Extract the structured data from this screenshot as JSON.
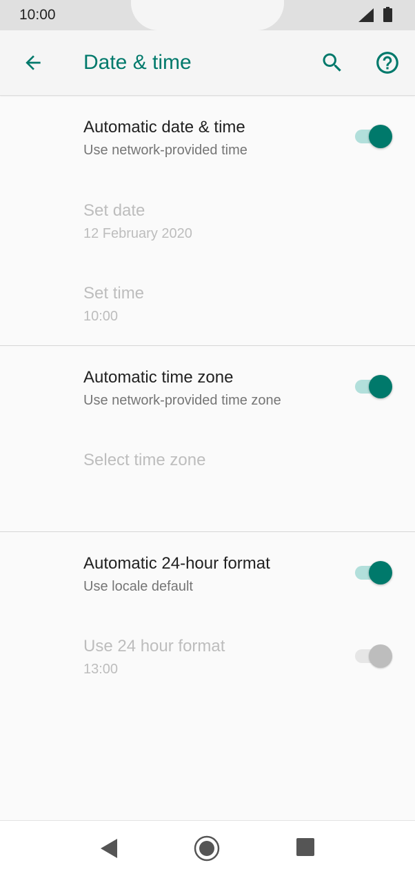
{
  "status_bar": {
    "time": "10:00",
    "icons": [
      "signal-icon",
      "battery-icon"
    ]
  },
  "app_bar": {
    "title": "Date & time",
    "icons": [
      "back-arrow-icon",
      "search-icon",
      "help-icon"
    ]
  },
  "colors": {
    "accent": "#00796b",
    "switch_track_on": "#b2dfdb",
    "text_primary": "#212121",
    "text_secondary": "#757575",
    "text_disabled": "#bdbdbd"
  },
  "prefs": {
    "auto_date_time": {
      "title": "Automatic date & time",
      "summary": "Use network-provided time",
      "checked": true,
      "enabled": true
    },
    "set_date": {
      "title": "Set date",
      "summary": "12 February 2020",
      "enabled": false
    },
    "set_time": {
      "title": "Set time",
      "summary": "10:00",
      "enabled": false
    },
    "auto_time_zone": {
      "title": "Automatic time zone",
      "summary": "Use network-provided time zone",
      "checked": true,
      "enabled": true
    },
    "select_time_zone": {
      "title": "Select time zone",
      "enabled": false
    },
    "auto_24_hour": {
      "title": "Automatic 24-hour format",
      "summary": "Use locale default",
      "checked": true,
      "enabled": true
    },
    "use_24_hour": {
      "title": "Use 24 hour format",
      "summary": "13:00",
      "checked": false,
      "enabled": false
    }
  },
  "nav_bar": {
    "icons": [
      "nav-back-icon",
      "nav-home-icon",
      "nav-recents-icon"
    ]
  }
}
